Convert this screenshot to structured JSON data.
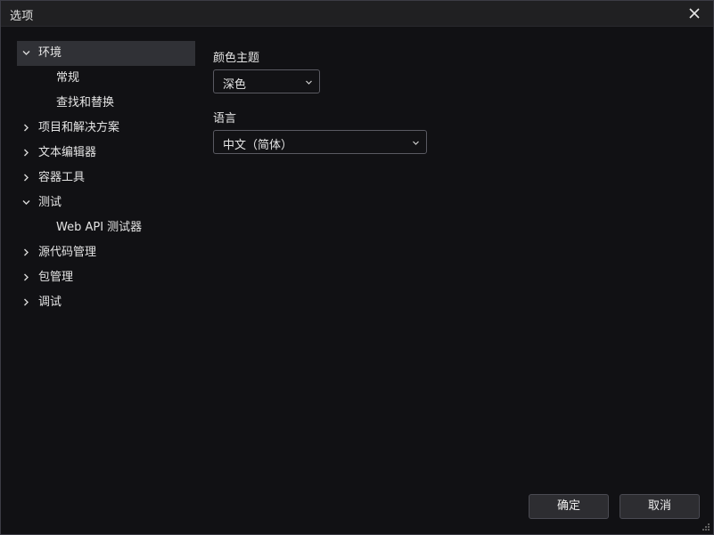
{
  "window": {
    "title": "选项"
  },
  "sidebar": {
    "items": [
      {
        "label": "环境",
        "expanded": true,
        "selected": true,
        "icon": "chevron-down-icon"
      },
      {
        "label": "常规",
        "child": true
      },
      {
        "label": "查找和替换",
        "child": true
      },
      {
        "label": "项目和解决方案",
        "expanded": false,
        "icon": "chevron-right-icon"
      },
      {
        "label": "文本编辑器",
        "expanded": false,
        "icon": "chevron-right-icon"
      },
      {
        "label": "容器工具",
        "expanded": false,
        "icon": "chevron-right-icon"
      },
      {
        "label": "测试",
        "expanded": true,
        "icon": "chevron-down-icon"
      },
      {
        "label": "Web API 测试器",
        "child": true
      },
      {
        "label": "源代码管理",
        "expanded": false,
        "icon": "chevron-right-icon"
      },
      {
        "label": "包管理",
        "expanded": false,
        "icon": "chevron-right-icon"
      },
      {
        "label": "调试",
        "expanded": false,
        "icon": "chevron-right-icon"
      }
    ]
  },
  "settings": {
    "theme": {
      "label": "颜色主题",
      "value": "深色"
    },
    "language": {
      "label": "语言",
      "value": "中文（简体）"
    }
  },
  "footer": {
    "ok_label": "确定",
    "cancel_label": "取消"
  },
  "colors": {
    "background": "#111114",
    "titlebar": "#202022",
    "selected_item": "#303136",
    "text": "#e4e4e4",
    "border": "#5a5a62"
  }
}
